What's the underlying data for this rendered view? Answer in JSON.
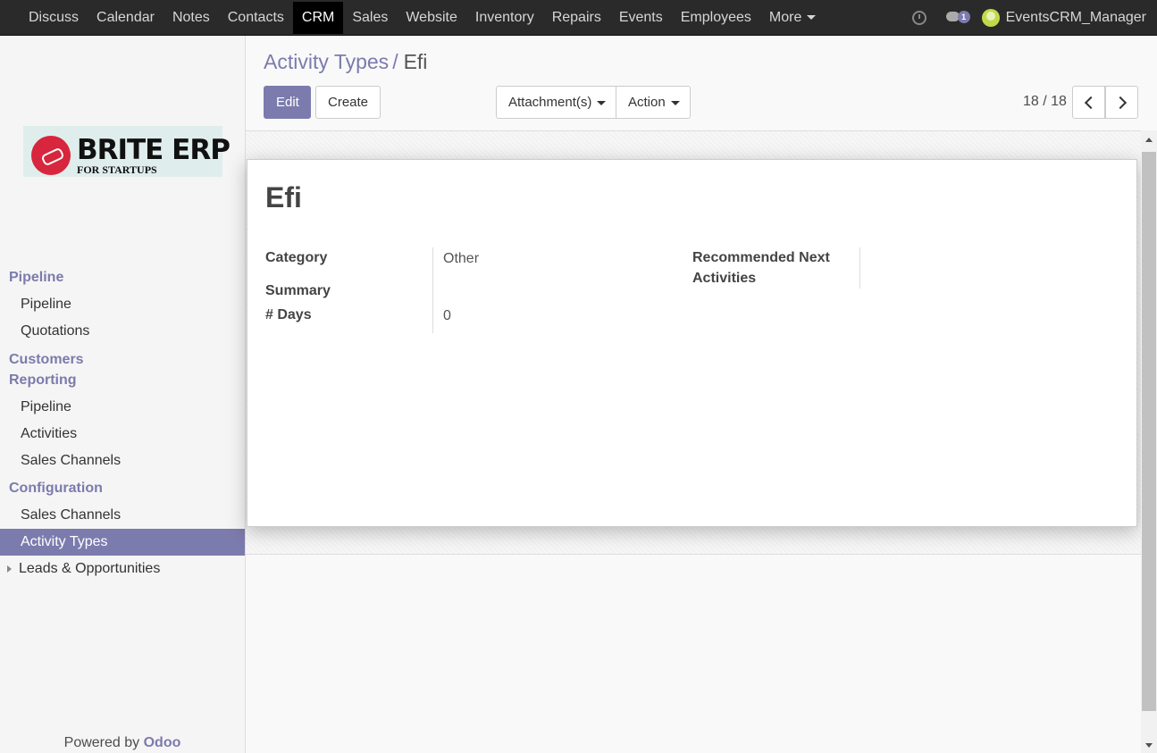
{
  "topbar": {
    "apps": [
      "Discuss",
      "Calendar",
      "Notes",
      "Contacts",
      "CRM",
      "Sales",
      "Website",
      "Inventory",
      "Repairs",
      "Events",
      "Employees"
    ],
    "active_app": "CRM",
    "more_label": "More",
    "chat_badge": "1",
    "user": "EventsCRM_Manager"
  },
  "logo": {
    "brand": "BRITE ERP",
    "tagline": "FOR STARTUPS"
  },
  "sidebar": {
    "pipeline_head": "Pipeline",
    "pipeline_items": [
      "Pipeline",
      "Quotations"
    ],
    "customers_head": "Customers",
    "reporting_head": "Reporting",
    "reporting_items": [
      "Pipeline",
      "Activities",
      "Sales Channels"
    ],
    "config_head": "Configuration",
    "config_items": [
      "Sales Channels",
      "Activity Types"
    ],
    "leads_item": "Leads & Opportunities",
    "powered_prefix": "Powered by",
    "powered_brand": "Odoo"
  },
  "breadcrumb": {
    "parent": "Activity Types",
    "separator": "/",
    "current": "Efi"
  },
  "buttons": {
    "edit": "Edit",
    "create": "Create",
    "attachments": "Attachment(s)",
    "action": "Action"
  },
  "pager": {
    "text": "18 / 18"
  },
  "record": {
    "title": "Efi",
    "category_label": "Category",
    "category_value": "Other",
    "summary_label": "Summary",
    "days_label": "# Days",
    "days_value": "0",
    "next_label_line1": "Recommended Next",
    "next_label_line2": "Activities"
  },
  "colors": {
    "accent": "#7c7bad",
    "topbar": "#2a2a2a"
  }
}
